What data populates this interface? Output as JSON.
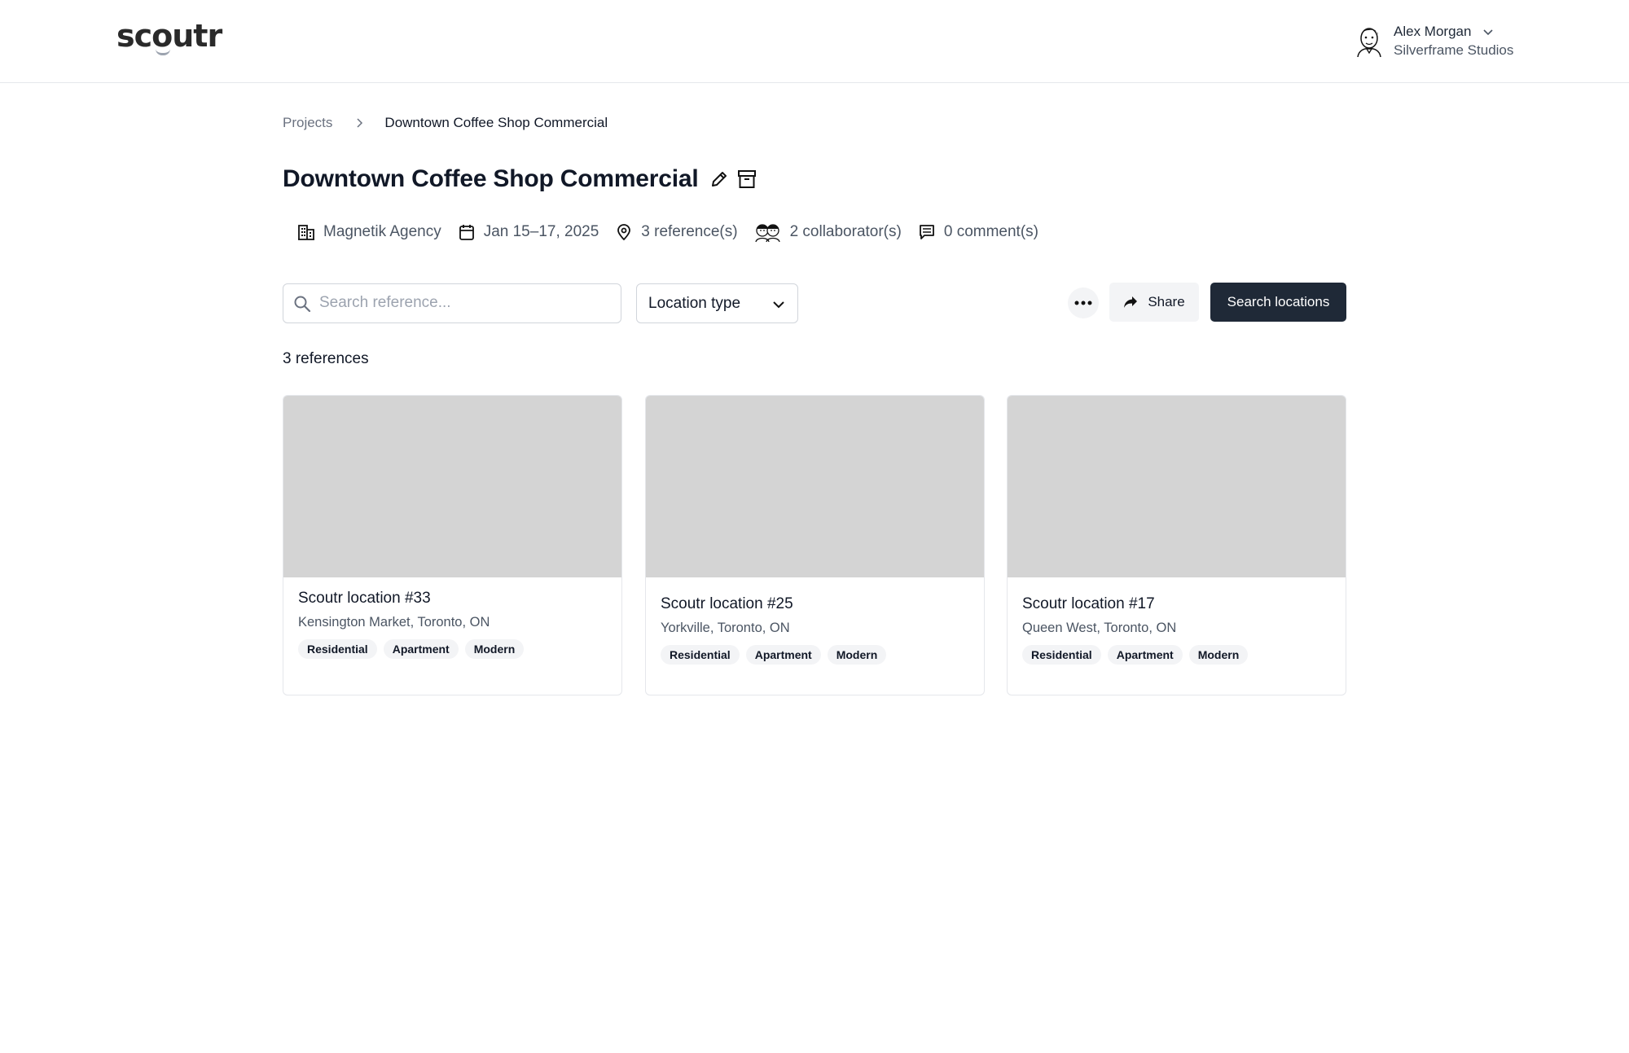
{
  "header": {
    "logo": "scoutr",
    "user_name": "Alex Morgan",
    "user_org": "Silverframe Studios"
  },
  "breadcrumb": {
    "root": "Projects",
    "current": "Downtown Coffee Shop Commercial"
  },
  "project": {
    "title": "Downtown Coffee Shop Commercial",
    "meta": {
      "agency": "Magnetik Agency",
      "dates": "Jan 15–17, 2025",
      "references": "3 reference(s)",
      "collaborators": "2 collaborator(s)",
      "comments": "0 comment(s)"
    }
  },
  "toolbar": {
    "search_placeholder": "Search reference...",
    "location_type_label": "Location type",
    "share_label": "Share",
    "search_locations_label": "Search locations"
  },
  "results": {
    "count_label": "3 references",
    "cards": [
      {
        "title": "Scoutr location #33",
        "address": "Kensington Market, Toronto, ON",
        "tags": [
          "Residential",
          "Apartment",
          "Modern"
        ]
      },
      {
        "title": "Scoutr location #25",
        "address": "Yorkville, Toronto, ON",
        "tags": [
          "Residential",
          "Apartment",
          "Modern"
        ]
      },
      {
        "title": "Scoutr location #17",
        "address": "Queen West, Toronto, ON",
        "tags": [
          "Residential",
          "Apartment",
          "Modern"
        ]
      }
    ]
  },
  "colors": {
    "primary_button": "#1f2937",
    "image_placeholder": "#d4d4d4",
    "tag_background": "#f3f4f6",
    "muted_text": "#4b5563"
  }
}
